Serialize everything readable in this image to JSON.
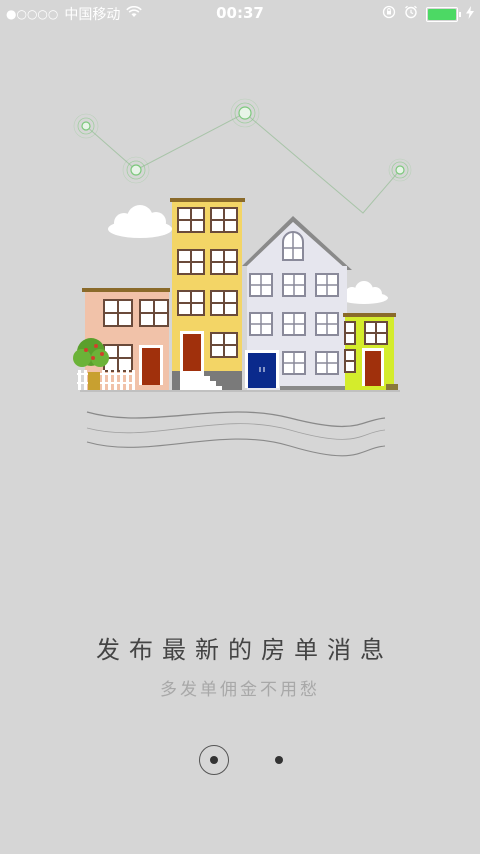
{
  "status_bar": {
    "signal": "●○○○○",
    "carrier": "中国移动",
    "time": "00:37",
    "battery_level": 1.0,
    "battery_color": "#4cd964"
  },
  "onboarding": {
    "title": "发布最新的房单消息",
    "subtitle": "多发单佣金不用愁",
    "pager": {
      "total": 2,
      "current": 1
    }
  },
  "colors": {
    "background": "#d6d6d6",
    "title_text": "#444444",
    "subtitle_text": "#a8a8a8",
    "accent_green": "#4cd964"
  }
}
